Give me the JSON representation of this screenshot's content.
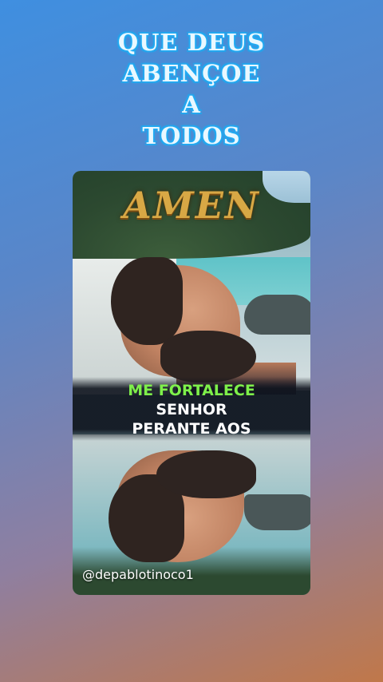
{
  "headline": {
    "line1": "QUE DEUS",
    "line2": "ABENÇOE",
    "line3": "A",
    "line4": "TODOS"
  },
  "video": {
    "overlay_title": "AMEN",
    "caption": {
      "line1": "ME FORTALECE",
      "line2": "SENHOR",
      "line3": "PERANTE AOS"
    },
    "handle": "@depablotinoco1"
  },
  "colors": {
    "caption_highlight": "#7ef04a",
    "headline_glow": "#1fb7ff",
    "amen_gold": "#d8a845"
  }
}
